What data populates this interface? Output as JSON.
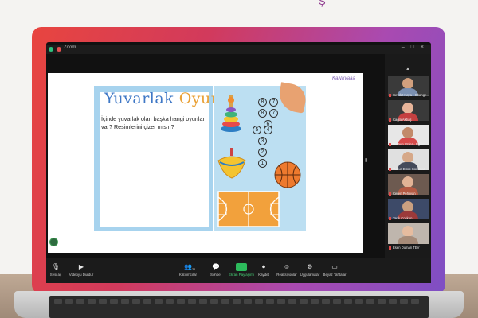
{
  "brand_mark": "Ş",
  "window": {
    "title": "Zoom",
    "controls": "– □ ×"
  },
  "slide": {
    "logo": "KaNaVaaa",
    "title_part1": "Yuvarlak ",
    "title_part2": "Oyunlar",
    "question": "İçinde yuvarlak olan başka hangi oyunlar var? Resimlerini çizer misin?",
    "hopscotch_numbers": [
      "8",
      "7",
      "6",
      "5",
      "4",
      "3",
      "2",
      "1"
    ]
  },
  "participants": [
    {
      "name": "Cevdet Kaya - Change...",
      "skin": "#d2a07e",
      "shirt": "#7a8fb0"
    },
    {
      "name": "Çağla Akbaş",
      "skin": "#e8b59a",
      "shirt": "#c54040"
    },
    {
      "name": "Meltem Güler - Eğitim",
      "skin": "#c28a6a",
      "shirt": "#d64b4b"
    },
    {
      "name": "Yunus Emre Korkmaz",
      "skin": "#d6a888",
      "shirt": "#444a5a"
    },
    {
      "name": "Ceren Pehlivan",
      "skin": "#e2b395",
      "shirt": "#b45a43"
    },
    {
      "name": "Tarık Coşkun",
      "skin": "#caa080",
      "shirt": "#9c3a3a"
    },
    {
      "name": "Esen Duman TEV",
      "skin": "#e6bc9f",
      "shirt": "#a68b78"
    }
  ],
  "toolbar": {
    "items": [
      {
        "icon": "🎙",
        "label": "Sesi aç"
      },
      {
        "icon": "▶",
        "label": "Videoyu Durdur"
      },
      {
        "icon": "👥",
        "label": "Katılımcılar",
        "badge": "21"
      },
      {
        "icon": "💬",
        "label": "Sohbet"
      },
      {
        "icon": "↑",
        "label": "Ekran Paylaşımı"
      },
      {
        "icon": "⏺",
        "label": "Kaydet"
      },
      {
        "icon": "☺",
        "label": "Reaksiyonlar"
      },
      {
        "icon": "⚙",
        "label": "Uygulamalar"
      },
      {
        "icon": "▭",
        "label": "Beyaz Tahtalar"
      }
    ]
  },
  "colors": {
    "share_green": "#2dbb5c",
    "laptop_gradient_start": "#e8453f",
    "laptop_gradient_end": "#7e4fc4"
  }
}
